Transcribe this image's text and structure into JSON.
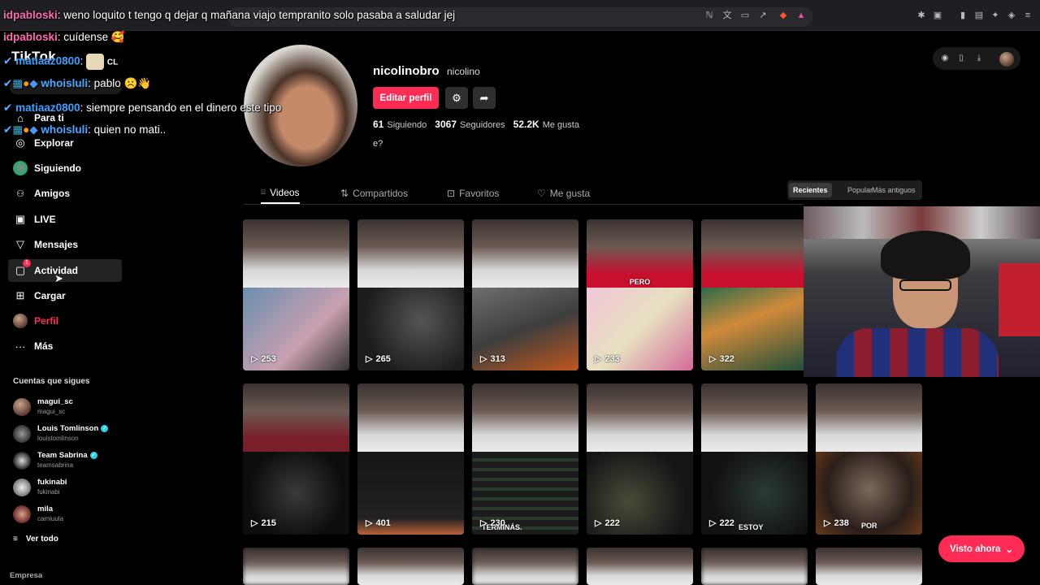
{
  "chat": [
    {
      "user": "idpabloski",
      "color": "#ff6ab0",
      "text": "weno loquito t tengo q dejar q mañana viajo tempranito solo pasaba a saludar jej"
    },
    {
      "user": "idpabloski",
      "color": "#ff6ab0",
      "text": "cuídense 🥰"
    },
    {
      "user": "matiaaz0800",
      "color": "#3aa0ff",
      "text": "",
      "trailing": "CL"
    },
    {
      "user": "whoisluli",
      "color": "#4aa8ff",
      "text": "pablo ☹️👋"
    },
    {
      "user": "matiaaz0800",
      "color": "#3aa0ff",
      "text": "siempre pensando en el dinero este tipo"
    },
    {
      "user": "whoisluli",
      "color": "#4aa8ff",
      "text": "quien no mati.."
    }
  ],
  "sidebar": {
    "logo": "TikTok",
    "nav": [
      {
        "label": "Para ti",
        "icon": "home-icon",
        "glyph": "⌂"
      },
      {
        "label": "Explorar",
        "icon": "compass-icon",
        "glyph": "◎"
      },
      {
        "label": "Siguiendo",
        "icon": "following-avatar-icon",
        "glyph": ""
      },
      {
        "label": "Amigos",
        "icon": "friends-icon",
        "glyph": "👥"
      },
      {
        "label": "LIVE",
        "icon": "live-icon",
        "glyph": "▣"
      },
      {
        "label": "Mensajes",
        "icon": "messages-icon",
        "glyph": "▽"
      },
      {
        "label": "Actividad",
        "icon": "activity-icon",
        "glyph": "▢",
        "badge": "1"
      },
      {
        "label": "Cargar",
        "icon": "upload-icon",
        "glyph": "⊞"
      },
      {
        "label": "Perfil",
        "icon": "profile-avatar-icon",
        "glyph": ""
      },
      {
        "label": "Más",
        "icon": "more-icon",
        "glyph": "···"
      }
    ],
    "following_title": "Cuentas que sigues",
    "following": [
      {
        "name": "magui_sc",
        "user": "magui_sc",
        "verified": false
      },
      {
        "name": "Louis Tomlinson",
        "user": "louistomlinson",
        "verified": true
      },
      {
        "name": "Team Sabrina",
        "user": "teamsabrina",
        "verified": true
      },
      {
        "name": "fukinabi",
        "user": "fukinabi",
        "verified": false
      },
      {
        "name": "mila",
        "user": "camiuula",
        "verified": false
      }
    ],
    "see_all": "Ver todo",
    "footer": "Empresa"
  },
  "profile": {
    "username": "nicolinobro",
    "nickname": "nicolino",
    "edit_label": "Editar perfil",
    "following_count": "61",
    "following_label": "Siguiendo",
    "followers_count": "3067",
    "followers_label": "Seguidores",
    "likes_count": "52.2K",
    "likes_label": "Me gusta",
    "bio": "e?"
  },
  "tabs": [
    {
      "label": "Videos",
      "glyph": "⦙⦙⦙",
      "active": true
    },
    {
      "label": "Compartidos",
      "glyph": "⇅",
      "active": false
    },
    {
      "label": "Favoritos",
      "glyph": "⊡",
      "active": false
    },
    {
      "label": "Me gusta",
      "glyph": "♡",
      "active": false
    }
  ],
  "sort": {
    "options": [
      "Recientes",
      "Popular",
      "Más antiguos"
    ],
    "selected": "Recientes"
  },
  "videos": [
    {
      "views": "253",
      "caption": ""
    },
    {
      "views": "265",
      "caption": ""
    },
    {
      "views": "313",
      "caption": ""
    },
    {
      "views": "233",
      "caption": "PERO"
    },
    {
      "views": "322",
      "caption": ""
    },
    {
      "views": "215",
      "caption": ""
    },
    {
      "views": "401",
      "caption": ""
    },
    {
      "views": "230",
      "caption": "TERMINÁS."
    },
    {
      "views": "222",
      "caption": ""
    },
    {
      "views": "222",
      "caption": "ESTOY"
    },
    {
      "views": "238",
      "caption": "POR"
    }
  ],
  "visto_ahora": "Visto ahora",
  "colors": {
    "accent": "#fe2c55",
    "background": "#000000",
    "verified": "#20d5ec"
  }
}
